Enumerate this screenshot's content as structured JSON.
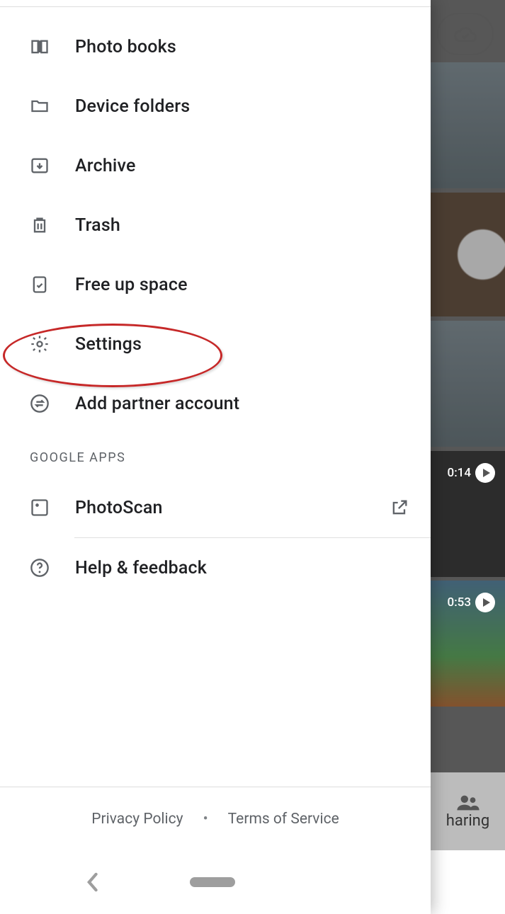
{
  "drawer": {
    "menu": [
      {
        "id": "photo-books",
        "label": "Photo books"
      },
      {
        "id": "device-folders",
        "label": "Device folders"
      },
      {
        "id": "archive",
        "label": "Archive"
      },
      {
        "id": "trash",
        "label": "Trash"
      },
      {
        "id": "free-up-space",
        "label": "Free up space"
      },
      {
        "id": "settings",
        "label": "Settings"
      },
      {
        "id": "add-partner",
        "label": "Add partner account"
      }
    ],
    "section_header": "GOOGLE APPS",
    "apps": [
      {
        "id": "photoscan",
        "label": "PhotoScan"
      }
    ],
    "help": {
      "label": "Help & feedback"
    },
    "footer": {
      "privacy": "Privacy Policy",
      "terms": "Terms of Service"
    }
  },
  "background": {
    "video_durations": [
      "0:14",
      "0:53"
    ],
    "bottom_nav_label_fragment": "haring"
  }
}
